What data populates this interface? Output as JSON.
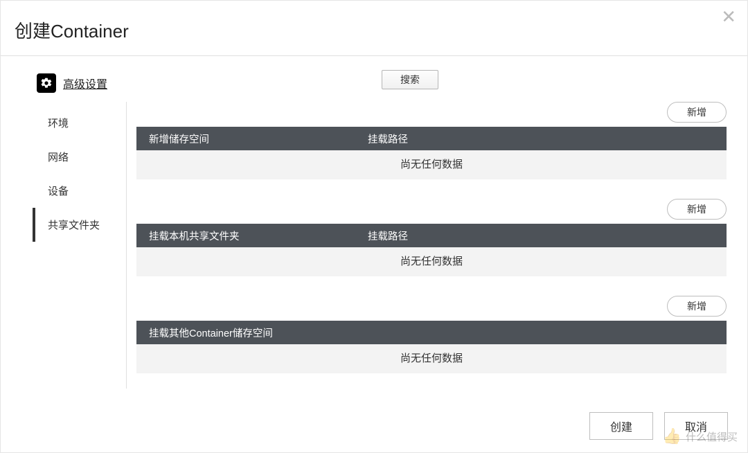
{
  "dialog": {
    "title": "创建Container",
    "close_glyph": "✕"
  },
  "advanced": {
    "label": "高级设置"
  },
  "search": {
    "label": "搜索"
  },
  "sidebar": {
    "items": [
      {
        "label": "环境",
        "active": false
      },
      {
        "label": "网络",
        "active": false
      },
      {
        "label": "设备",
        "active": false
      },
      {
        "label": "共享文件夹",
        "active": true
      }
    ]
  },
  "sections": [
    {
      "add_label": "新增",
      "columns": [
        "新增储存空间",
        "挂载路径"
      ],
      "empty_text": "尚无任何数据"
    },
    {
      "add_label": "新增",
      "columns": [
        "挂载本机共享文件夹",
        "挂载路径"
      ],
      "empty_text": "尚无任何数据"
    },
    {
      "add_label": "新增",
      "columns": [
        "挂载其他Container储存空间"
      ],
      "empty_text": "尚无任何数据"
    }
  ],
  "footer": {
    "create": "创建",
    "cancel": "取消"
  },
  "watermark": {
    "text": "什么值得买"
  }
}
